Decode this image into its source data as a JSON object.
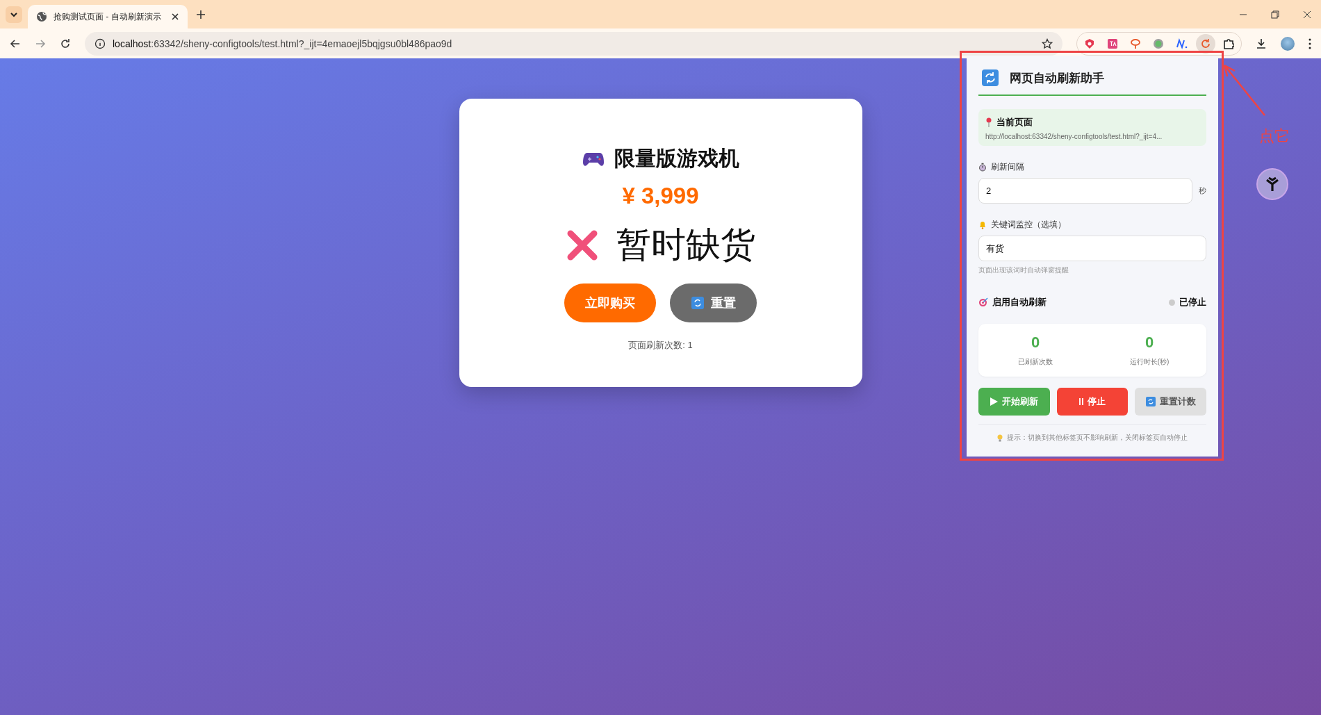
{
  "browser": {
    "tabs": [
      {
        "title": "抢购测试页面 - 自动刷新演示",
        "selected": true
      }
    ],
    "address": {
      "host": "localhost",
      "rest": ":63342/sheny-configtools/test.html?_ijt=4emaoejl5bqjgsu0bl486pao9d"
    }
  },
  "product": {
    "title": "限量版游戏机",
    "price": "¥ 3,999",
    "stock_status": "暂时缺货",
    "in_stock": false,
    "buttons": [
      {
        "label": "立即购买",
        "kind": "buy"
      },
      {
        "label": "重置",
        "kind": "reset"
      }
    ],
    "refresh_count": "页面刷新次数: 1"
  },
  "popup": {
    "title": "网页自动刷新助手",
    "current_page": {
      "label": "当前页面",
      "url": "http://localhost:63342/sheny-configtools/test.html?_ijt=4..."
    },
    "interval": {
      "label": "刷新间隔",
      "value": "2",
      "unit": "秒"
    },
    "keyword": {
      "label": "关键词监控（选填）",
      "value": "有货",
      "hint": "页面出现该词时自动弹窗提醒"
    },
    "auto_refresh": {
      "label": "启用自动刷新",
      "status": "已停止",
      "running": false
    },
    "stats": [
      {
        "value": "0",
        "label": "已刷新次数"
      },
      {
        "value": "0",
        "label": "运行时长(秒)"
      }
    ],
    "buttons": [
      {
        "label": "开始刷新",
        "kind": "start"
      },
      {
        "label": "停止",
        "kind": "stop"
      },
      {
        "label": "重置计数",
        "kind": "reset"
      }
    ],
    "tip": "提示：切换到其他标签页不影响刷新，关闭标签页自动停止"
  },
  "annotation": {
    "text": "点它"
  }
}
